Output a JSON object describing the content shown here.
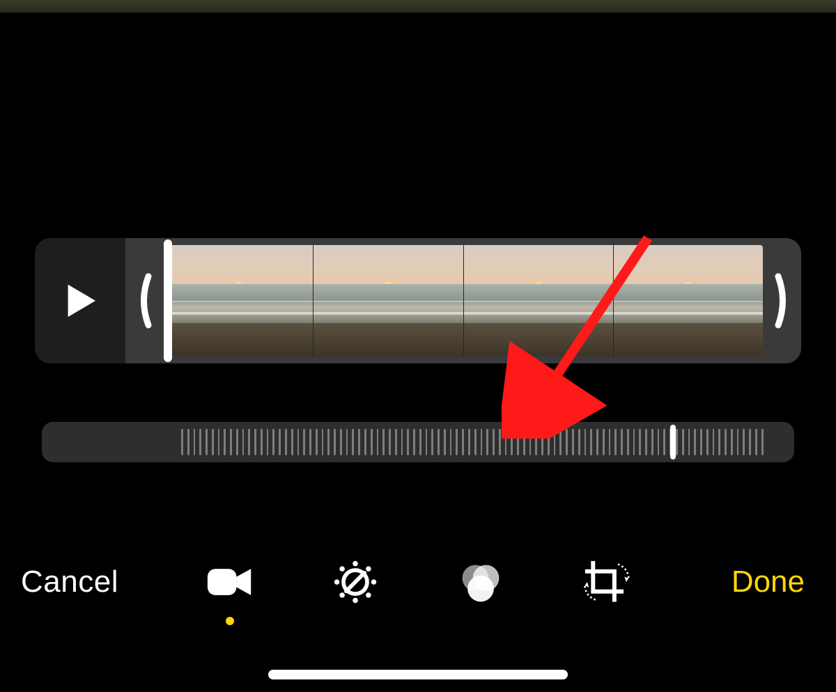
{
  "buttons": {
    "cancel": "Cancel",
    "done": "Done"
  },
  "tabs": {
    "items": [
      "video",
      "adjust",
      "filters",
      "crop"
    ],
    "selected": "video"
  },
  "slider": {
    "position_percent": 84
  },
  "timeline": {
    "frame_count": 4,
    "playhead_at_start": true
  },
  "colors": {
    "accent": "#ffd60a",
    "annotation": "#ff1a1a"
  },
  "annotation": {
    "type": "arrow",
    "points_to": "slider"
  }
}
